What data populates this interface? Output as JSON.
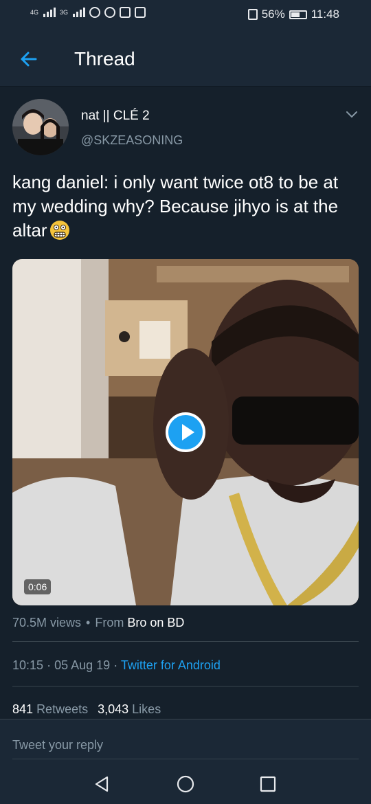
{
  "status_bar": {
    "signal1_label": "4G",
    "signal2_label": "3G",
    "icons": [
      "alarm-icon",
      "whatsapp-icon",
      "image-notification-icon",
      "message-notification-icon"
    ],
    "battery_percent": "56%",
    "time": "11:48"
  },
  "app_bar": {
    "back_icon": "arrow-left-icon",
    "title": "Thread"
  },
  "author": {
    "name": "nat || CLÉ 2",
    "handle": "@SKZEASONING"
  },
  "tweet": {
    "text": "kang daniel: i only want twice ot8 to be at my wedding why? Because jihyo is at the altar",
    "emoji": "grimacing-face-icon",
    "video": {
      "duration": "0:06",
      "play_icon": "play-icon"
    },
    "views": "70.5M views",
    "views_separator": "•",
    "from_label": "From",
    "source": "Bro on BD",
    "time": "10:15",
    "separator": "·",
    "date": "05 Aug 19",
    "client": "Twitter for Android",
    "retweets_count": "841",
    "retweets_label": "Retweets",
    "likes_count": "3,043",
    "likes_label": "Likes"
  },
  "reply": {
    "placeholder": "Tweet your reply"
  },
  "nav_bar": {
    "icons": [
      "back-triangle-icon",
      "home-circle-icon",
      "recents-square-icon"
    ]
  },
  "colors": {
    "background": "#15202b",
    "bar": "#1b2836",
    "accent": "#1da1f2",
    "secondary_text": "#8899a6",
    "divider": "#38444d"
  }
}
